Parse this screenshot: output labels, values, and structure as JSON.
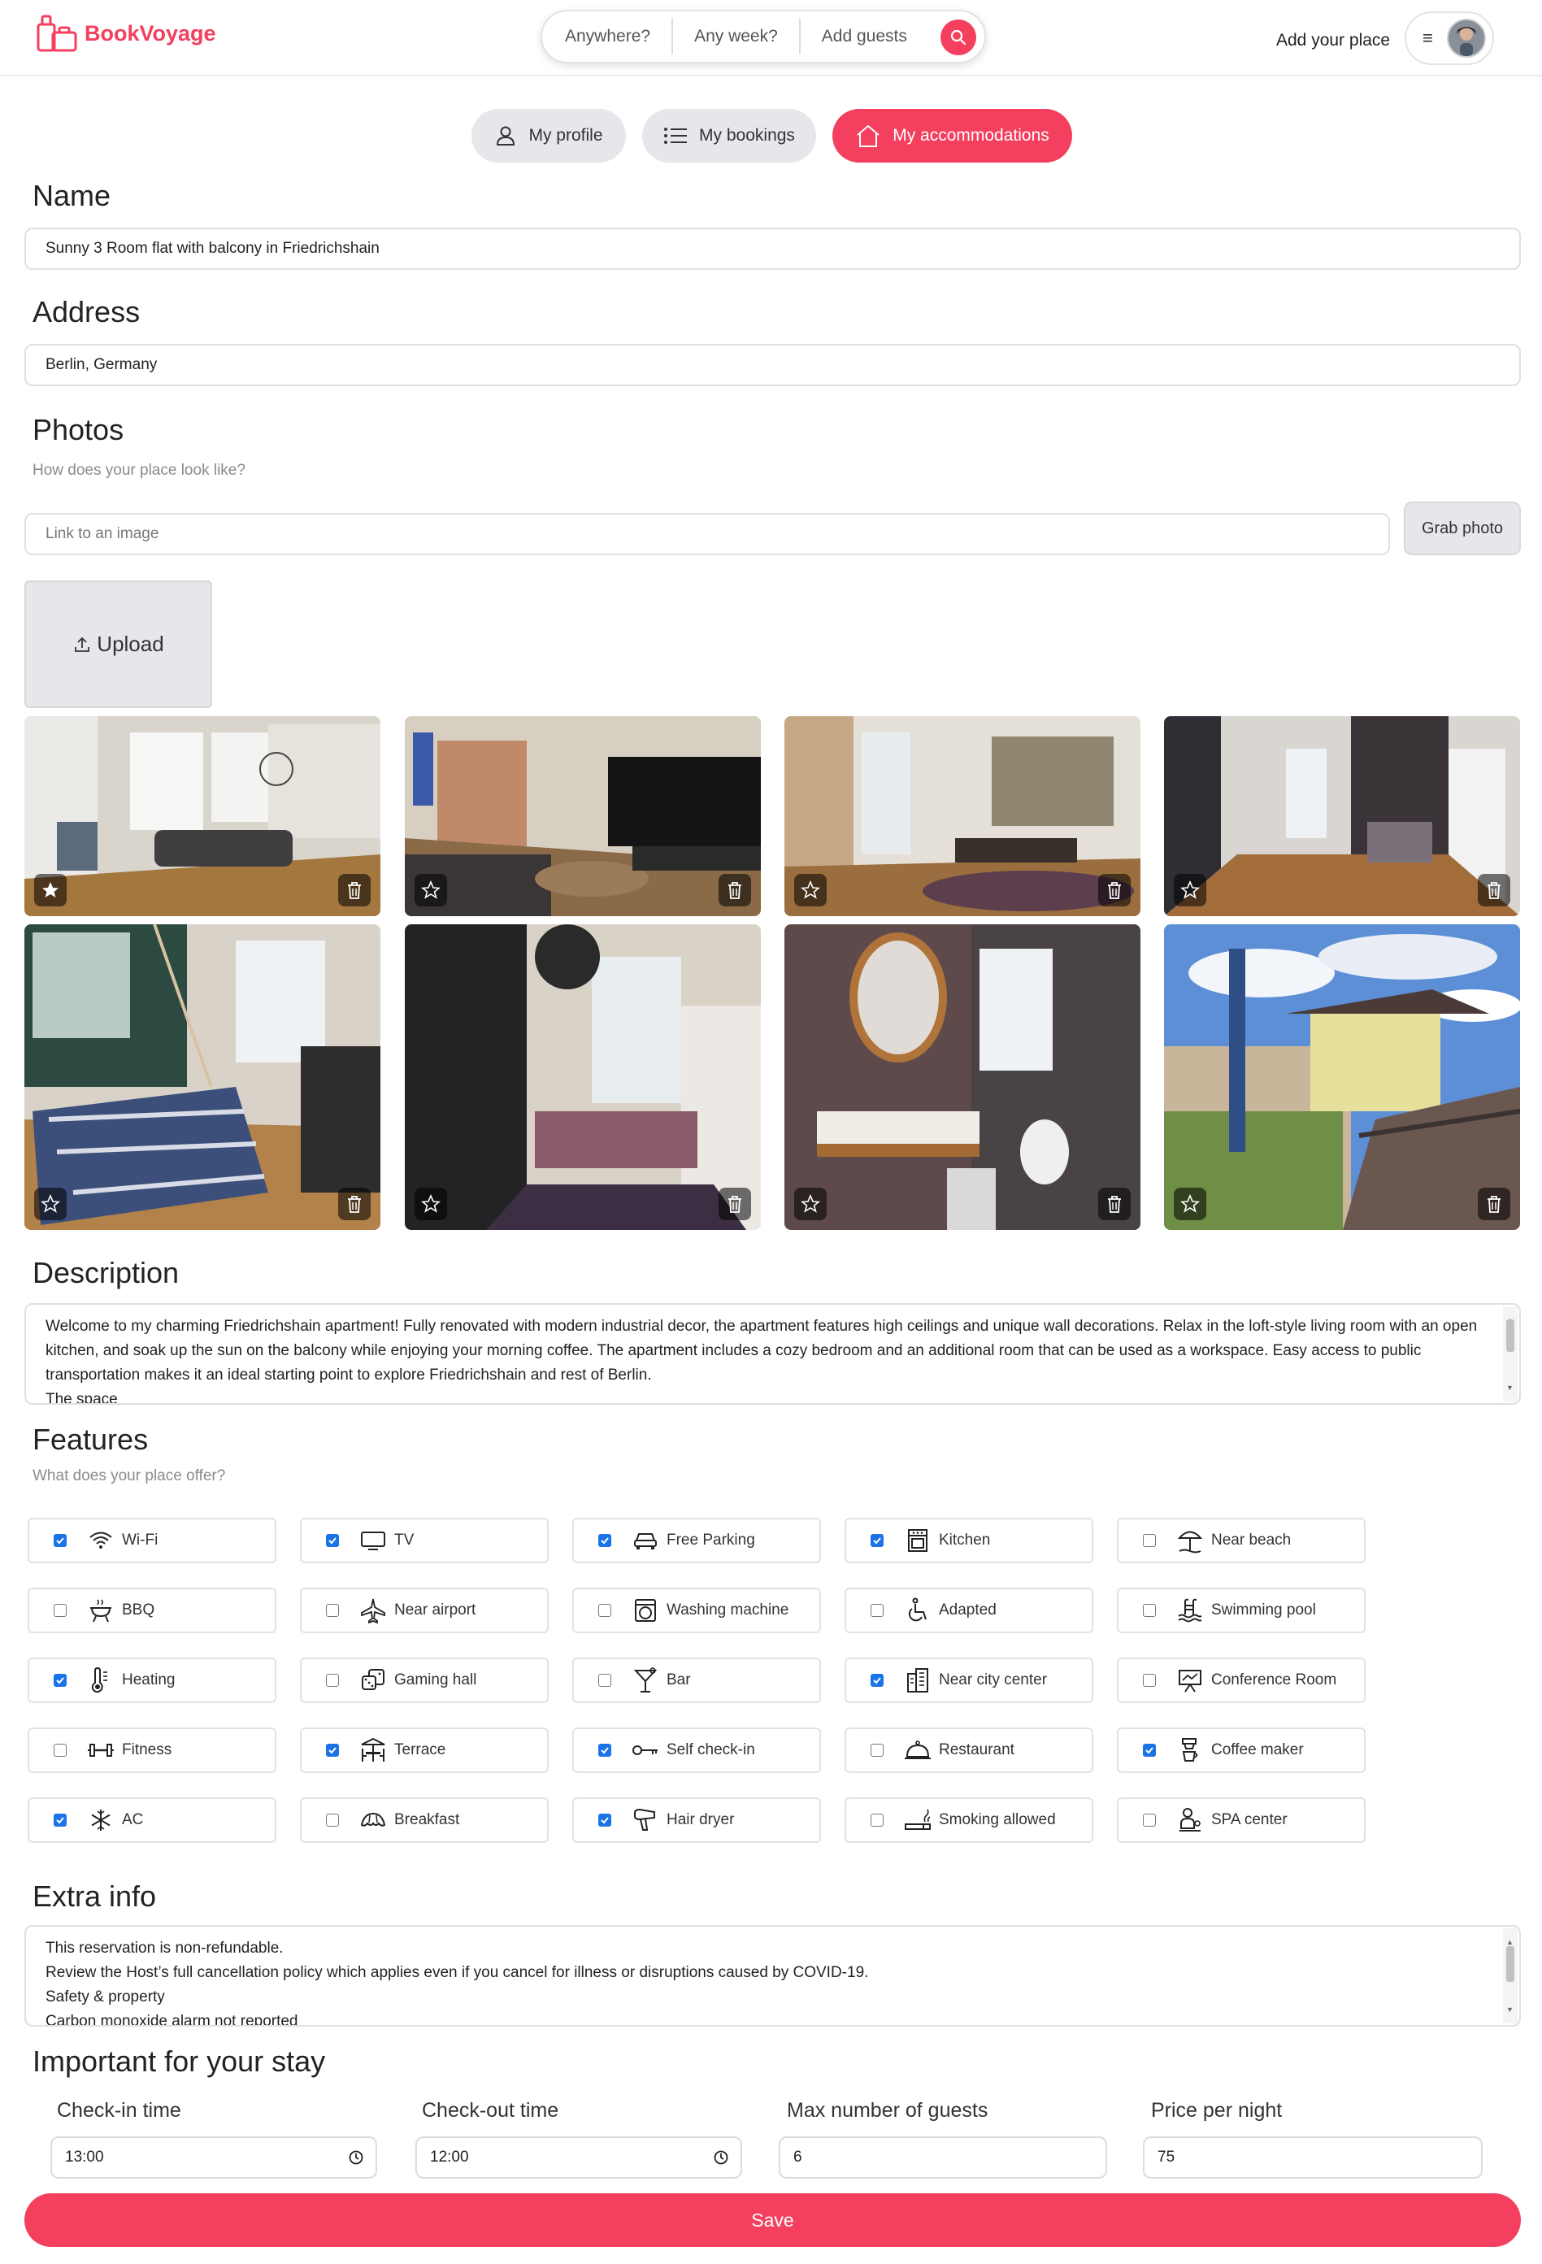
{
  "header": {
    "logo_text": "BookVoyage",
    "search": {
      "where": "Anywhere?",
      "when": "Any week?",
      "guests": "Add guests"
    },
    "add_place": "Add your place"
  },
  "tabs": [
    {
      "label": "My profile",
      "icon": "user-icon",
      "active": false
    },
    {
      "label": "My bookings",
      "icon": "list-icon",
      "active": false
    },
    {
      "label": "My accommodations",
      "icon": "home-icon",
      "active": true
    }
  ],
  "name": {
    "heading": "Name",
    "value": "Sunny 3 Room flat with balcony in Friedrichshain"
  },
  "address": {
    "heading": "Address",
    "value": "Berlin, Germany"
  },
  "photos": {
    "heading": "Photos",
    "hint": "How does your place look like?",
    "link_placeholder": "Link to an image",
    "grab_label": "Grab photo",
    "upload_label": "Upload",
    "items": [
      {
        "scene": "living room",
        "main": true
      },
      {
        "scene": "living room with tv",
        "main": false
      },
      {
        "scene": "dining area",
        "main": false
      },
      {
        "scene": "kitchen hallway",
        "main": false
      },
      {
        "scene": "bedroom",
        "main": false
      },
      {
        "scene": "second bedroom",
        "main": false
      },
      {
        "scene": "bathroom",
        "main": false
      },
      {
        "scene": "balcony",
        "main": false
      }
    ]
  },
  "description": {
    "heading": "Description",
    "text": "Welcome to my charming Friedrichshain apartment! Fully renovated with modern industrial decor, the apartment features high ceilings and unique wall decorations. Relax in the loft-style living room with an open kitchen, and soak up the sun on the balcony while enjoying your morning coffee. The apartment includes a cozy bedroom and an additional room that can be used as a workspace. Easy access to public transportation makes it an ideal starting point to explore Friedrichshain and rest of Berlin.\nThe space"
  },
  "features": {
    "heading": "Features",
    "hint": "What does your place offer?",
    "items": [
      {
        "label": "Wi-Fi",
        "icon": "wifi-icon",
        "checked": true
      },
      {
        "label": "TV",
        "icon": "tv-icon",
        "checked": true
      },
      {
        "label": "Free Parking",
        "icon": "car-icon",
        "checked": true
      },
      {
        "label": "Kitchen",
        "icon": "stove-icon",
        "checked": true
      },
      {
        "label": "Near beach",
        "icon": "beach-umbrella-icon",
        "checked": false
      },
      {
        "label": "BBQ",
        "icon": "grill-icon",
        "checked": false
      },
      {
        "label": "Near airport",
        "icon": "airplane-icon",
        "checked": false
      },
      {
        "label": "Washing machine",
        "icon": "washing-machine-icon",
        "checked": false
      },
      {
        "label": "Adapted",
        "icon": "wheelchair-icon",
        "checked": false
      },
      {
        "label": "Swimming pool",
        "icon": "pool-icon",
        "checked": false
      },
      {
        "label": "Heating",
        "icon": "thermometer-icon",
        "checked": true
      },
      {
        "label": "Gaming hall",
        "icon": "dice-icon",
        "checked": false
      },
      {
        "label": "Bar",
        "icon": "cocktail-icon",
        "checked": false
      },
      {
        "label": "Near city center",
        "icon": "building-icon",
        "checked": true
      },
      {
        "label": "Conference Room",
        "icon": "presentation-icon",
        "checked": false
      },
      {
        "label": "Fitness",
        "icon": "dumbbell-icon",
        "checked": false
      },
      {
        "label": "Terrace",
        "icon": "terrace-icon",
        "checked": true
      },
      {
        "label": "Self check-in",
        "icon": "key-icon",
        "checked": true
      },
      {
        "label": "Restaurant",
        "icon": "cloche-icon",
        "checked": false
      },
      {
        "label": "Coffee maker",
        "icon": "coffee-maker-icon",
        "checked": true
      },
      {
        "label": "AC",
        "icon": "snowflake-icon",
        "checked": true
      },
      {
        "label": "Breakfast",
        "icon": "croissant-icon",
        "checked": false
      },
      {
        "label": "Hair dryer",
        "icon": "hair-dryer-icon",
        "checked": true
      },
      {
        "label": "Smoking allowed",
        "icon": "cigarette-icon",
        "checked": false
      },
      {
        "label": "SPA center",
        "icon": "spa-icon",
        "checked": false
      }
    ]
  },
  "extra_info": {
    "heading": "Extra info",
    "text": "This reservation is non-refundable.\nReview the Host’s full cancellation policy which applies even if you cancel for illness or disruptions caused by COVID-19.\nSafety & property\nCarbon monoxide alarm not reported"
  },
  "important": {
    "heading": "Important for your stay",
    "checkin_label": "Check-in time",
    "checkin_value": "13:00",
    "checkout_label": "Check-out time",
    "checkout_value": "12:00",
    "guests_label": "Max number of guests",
    "guests_value": "6",
    "price_label": "Price per night",
    "price_value": "75"
  },
  "save_label": "Save",
  "colors": {
    "brand": "#f43f5e",
    "checkbox": "#1a73e8",
    "tab_inactive": "#e5e7eb"
  }
}
